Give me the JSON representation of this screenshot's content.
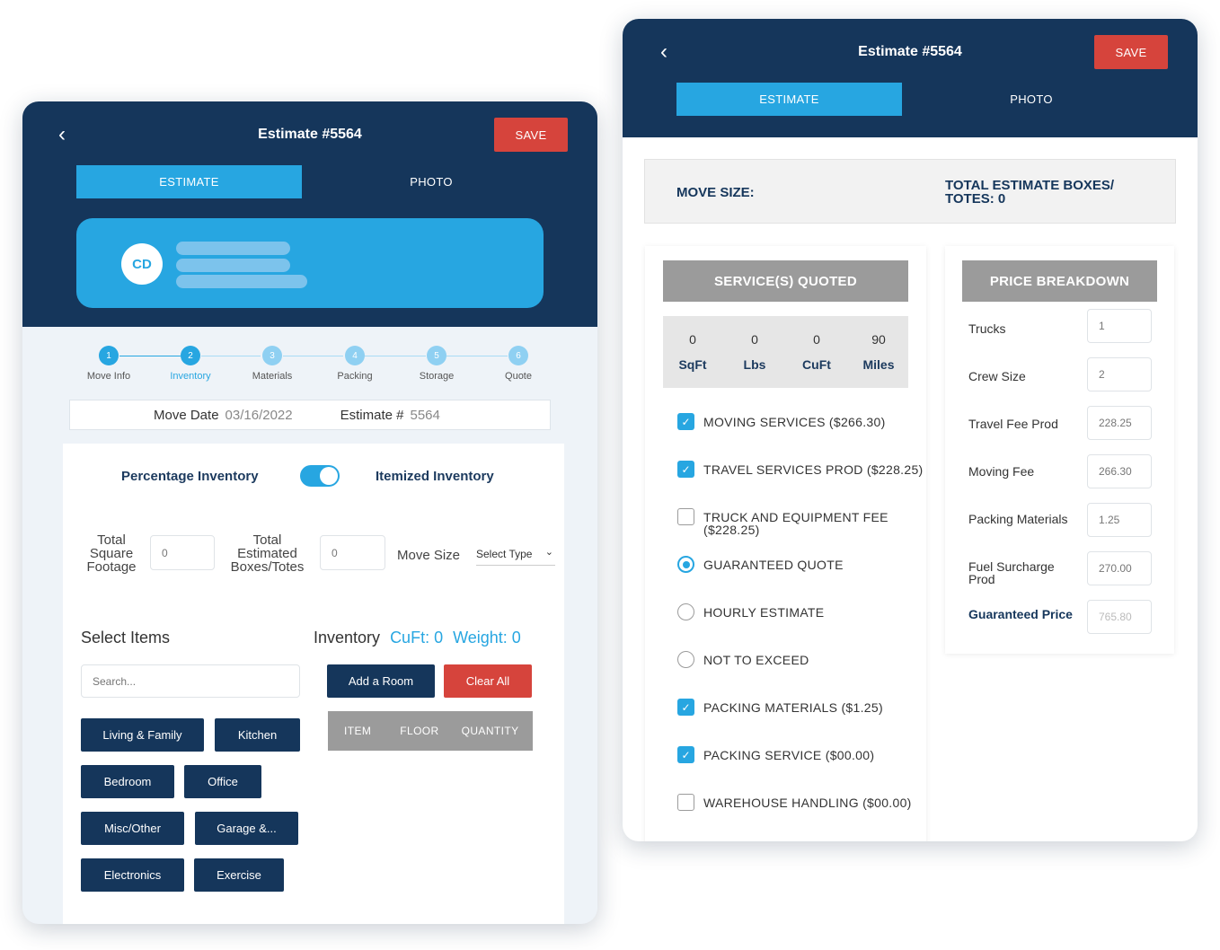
{
  "colors": {
    "navy": "#15365b",
    "accent": "#27a6e1",
    "danger": "#d6443c",
    "grey_header": "#9b9b9b"
  },
  "left": {
    "header": {
      "back_icon": "chevron-left-icon",
      "title": "Estimate #5564",
      "save_label": "SAVE"
    },
    "tabs": [
      {
        "label": "ESTIMATE",
        "active": true
      },
      {
        "label": "PHOTO",
        "active": false
      }
    ],
    "profile": {
      "initials": "CD"
    },
    "steps": [
      {
        "num": "1",
        "label": "Move Info"
      },
      {
        "num": "2",
        "label": "Inventory"
      },
      {
        "num": "3",
        "label": "Materials"
      },
      {
        "num": "4",
        "label": "Packing"
      },
      {
        "num": "5",
        "label": "Storage"
      },
      {
        "num": "6",
        "label": "Quote"
      }
    ],
    "move_date_label": "Move Date",
    "move_date_value": "03/16/2022",
    "estimate_label": "Estimate #",
    "estimate_value": "5564",
    "toggle": {
      "left_label": "Percentage Inventory",
      "right_label": "Itemized Inventory"
    },
    "fields": {
      "sqft_label": "Total Square Footage",
      "sqft_value": "0",
      "boxes_label": "Total Estimated Boxes/Totes",
      "boxes_value": "0",
      "move_size_label": "Move Size",
      "move_size_value": "Select Type"
    },
    "select_items_label": "Select Items",
    "search_placeholder": "Search...",
    "rooms": [
      "Living & Family",
      "Kitchen",
      "Bedroom",
      "Office",
      "Misc/Other",
      "Garage &...",
      "Electronics",
      "Exercise"
    ],
    "inventory": {
      "label": "Inventory",
      "cuft": "CuFt: 0",
      "weight": "Weight: 0",
      "add_room": "Add a Room",
      "clear_all": "Clear All",
      "columns": [
        "ITEM",
        "FLOOR",
        "QUANTITY"
      ]
    }
  },
  "right": {
    "header": {
      "back_icon": "chevron-left-icon",
      "title": "Estimate #5564",
      "save_label": "SAVE"
    },
    "tabs": [
      {
        "label": "ESTIMATE",
        "active": true
      },
      {
        "label": "PHOTO",
        "active": false
      }
    ],
    "move_size_label": "MOVE SIZE:",
    "total_boxes_line1": "TOTAL ESTIMATE BOXES/",
    "total_boxes_line2": "TOTES: 0",
    "services_title": "SERVICE(S) QUOTED",
    "stats": [
      {
        "value": "0",
        "unit": "SqFt"
      },
      {
        "value": "0",
        "unit": "Lbs"
      },
      {
        "value": "0",
        "unit": "CuFt"
      },
      {
        "value": "90",
        "unit": "Miles"
      }
    ],
    "options": [
      {
        "label": "MOVING SERVICES ($266.30)",
        "kind": "checkbox",
        "checked": true
      },
      {
        "label": "TRAVEL SERVICES PROD ($228.25)",
        "kind": "checkbox",
        "checked": true
      },
      {
        "label": "TRUCK AND EQUIPMENT FEE ($228.25)",
        "kind": "checkbox",
        "checked": false
      },
      {
        "label": "GUARANTEED QUOTE",
        "kind": "radio",
        "checked": true
      },
      {
        "label": "HOURLY ESTIMATE",
        "kind": "radio",
        "checked": false
      },
      {
        "label": "NOT TO EXCEED",
        "kind": "radio",
        "checked": false
      },
      {
        "label": "PACKING MATERIALS ($1.25)",
        "kind": "checkbox",
        "checked": true
      },
      {
        "label": "PACKING SERVICE ($00.00)",
        "kind": "checkbox",
        "checked": true
      },
      {
        "label": "WAREHOUSE HANDLING ($00.00)",
        "kind": "checkbox",
        "checked": false
      }
    ],
    "price_title": "PRICE BREAKDOWN",
    "prices": [
      {
        "label": "Trucks",
        "value": "1"
      },
      {
        "label": "Crew Size",
        "value": "2"
      },
      {
        "label": "Travel Fee Prod",
        "value": "228.25"
      },
      {
        "label": "Moving Fee",
        "value": "266.30"
      },
      {
        "label": "Packing Materials",
        "value": "1.25"
      },
      {
        "label": "Fuel Surcharge Prod",
        "value": "270.00"
      },
      {
        "label": "Guaranteed Price",
        "value": "765.80"
      }
    ]
  }
}
